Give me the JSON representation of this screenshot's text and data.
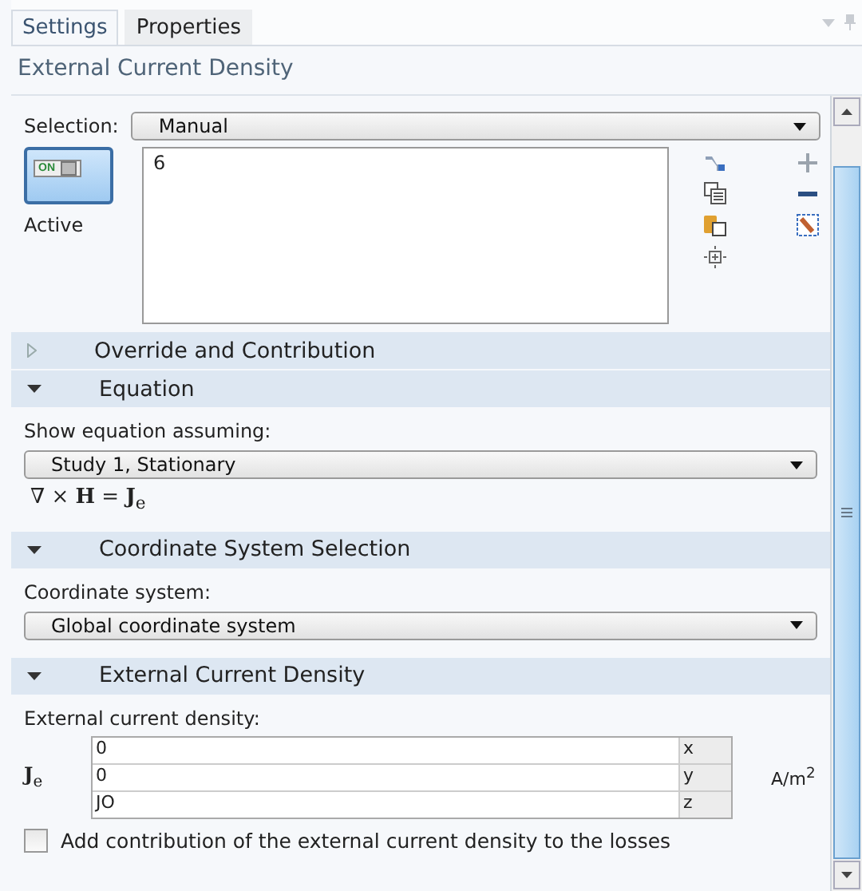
{
  "tabs": [
    {
      "label": "Settings",
      "selected": true
    },
    {
      "label": "Properties",
      "selected": false
    }
  ],
  "panel_title": "External Current Density",
  "selection": {
    "label": "Selection:",
    "value": "Manual",
    "active_label": "Active",
    "toggle_text": "ON",
    "active": true,
    "items": [
      "6"
    ]
  },
  "sections": [
    {
      "title": "Override and Contribution",
      "expanded": false
    },
    {
      "title": "Equation",
      "expanded": true,
      "kind": "equation",
      "field_label": "Show equation assuming:",
      "value": "Study 1, Stationary",
      "formula": "∇ × **H** = **J**$_{e}$"
    },
    {
      "title": "Coordinate System Selection",
      "expanded": true,
      "kind": "dropdown",
      "field_label": "Coordinate system:",
      "value": "Global coordinate system"
    },
    {
      "title": "External Current Density",
      "expanded": true,
      "kind": "vector",
      "field_label": "External current density:",
      "symbol": "**J**$_{e}$",
      "unit": "A/m$^{2}$",
      "rows": [
        {
          "value": "0",
          "axis": "x"
        },
        {
          "value": "0",
          "axis": "y"
        },
        {
          "value": "JO",
          "axis": "z"
        }
      ],
      "checkbox": {
        "label": "Add contribution of the external current density to the losses",
        "checked": false
      }
    }
  ]
}
